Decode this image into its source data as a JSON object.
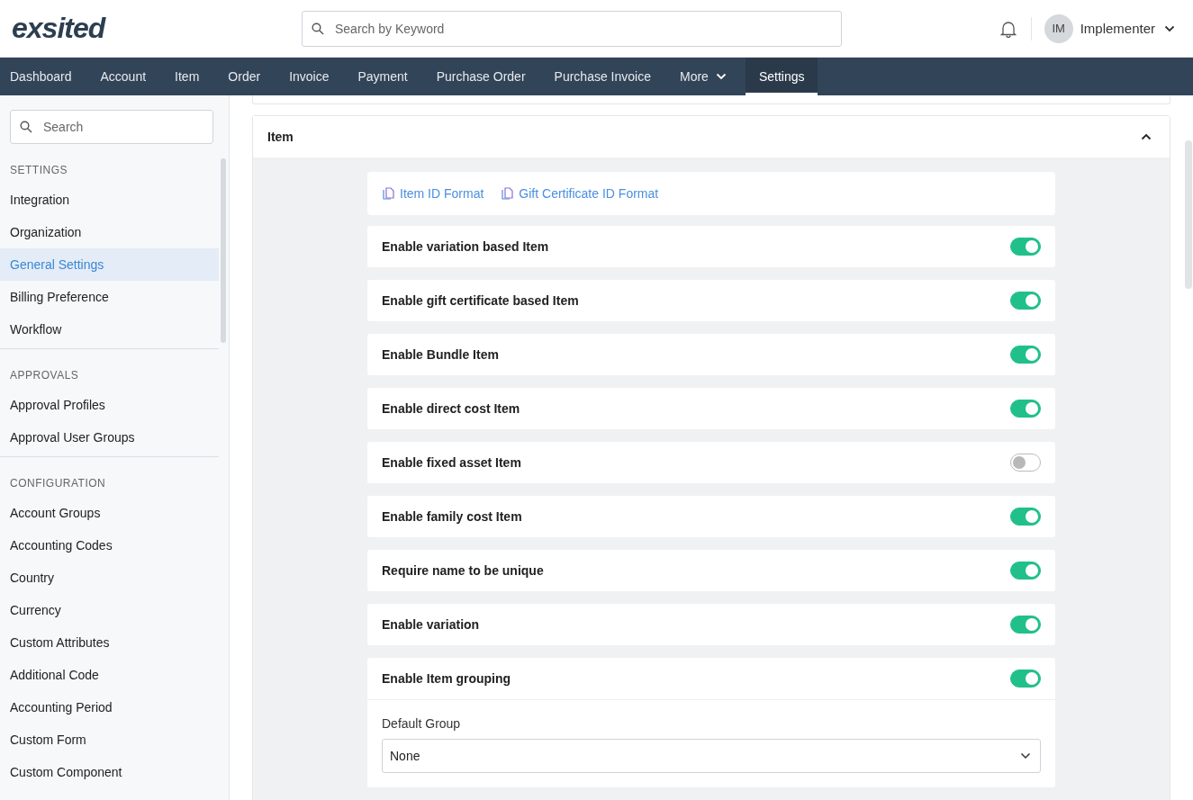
{
  "header": {
    "logo": "exsited",
    "search": {
      "placeholder": "Search by Keyword"
    },
    "user": {
      "initials": "IM",
      "name": "Implementer"
    }
  },
  "nav": [
    {
      "label": "Dashboard",
      "selected": false,
      "dropdown": false
    },
    {
      "label": "Account",
      "selected": false,
      "dropdown": false
    },
    {
      "label": "Item",
      "selected": false,
      "dropdown": false
    },
    {
      "label": "Order",
      "selected": false,
      "dropdown": false
    },
    {
      "label": "Invoice",
      "selected": false,
      "dropdown": false
    },
    {
      "label": "Payment",
      "selected": false,
      "dropdown": false
    },
    {
      "label": "Purchase Order",
      "selected": false,
      "dropdown": false
    },
    {
      "label": "Purchase Invoice",
      "selected": false,
      "dropdown": false
    },
    {
      "label": "More",
      "selected": false,
      "dropdown": true
    },
    {
      "label": "Settings",
      "selected": true,
      "dropdown": false
    }
  ],
  "sidebar": {
    "search": {
      "placeholder": "Search"
    },
    "sections": [
      {
        "heading": "SETTINGS",
        "items": [
          {
            "label": "Integration",
            "selected": false
          },
          {
            "label": "Organization",
            "selected": false
          },
          {
            "label": "General Settings",
            "selected": true
          },
          {
            "label": "Billing Preference",
            "selected": false
          },
          {
            "label": "Workflow",
            "selected": false
          }
        ]
      },
      {
        "heading": "APPROVALS",
        "items": [
          {
            "label": "Approval Profiles",
            "selected": false
          },
          {
            "label": "Approval User Groups",
            "selected": false
          }
        ]
      },
      {
        "heading": "CONFIGURATION",
        "items": [
          {
            "label": "Account Groups",
            "selected": false
          },
          {
            "label": "Accounting Codes",
            "selected": false
          },
          {
            "label": "Country",
            "selected": false
          },
          {
            "label": "Currency",
            "selected": false
          },
          {
            "label": "Custom Attributes",
            "selected": false
          },
          {
            "label": "Additional Code",
            "selected": false
          },
          {
            "label": "Accounting Period",
            "selected": false
          },
          {
            "label": "Custom Form",
            "selected": false
          },
          {
            "label": "Custom Component",
            "selected": false
          }
        ]
      }
    ]
  },
  "panel": {
    "title": "Item",
    "expanded": true,
    "links": [
      "Item ID Format",
      "Gift Certificate ID Format"
    ],
    "settings": [
      {
        "label": "Enable variation based Item",
        "on": true
      },
      {
        "label": "Enable gift certificate based Item",
        "on": true
      },
      {
        "label": "Enable Bundle Item",
        "on": true
      },
      {
        "label": "Enable direct cost Item",
        "on": true
      },
      {
        "label": "Enable fixed asset Item",
        "on": false
      },
      {
        "label": "Enable family cost Item",
        "on": true
      },
      {
        "label": "Require name to be unique",
        "on": true
      },
      {
        "label": "Enable variation",
        "on": true
      },
      {
        "label": "Enable Item grouping",
        "on": true,
        "field": {
          "label": "Default Group",
          "value": "None"
        }
      }
    ]
  }
}
